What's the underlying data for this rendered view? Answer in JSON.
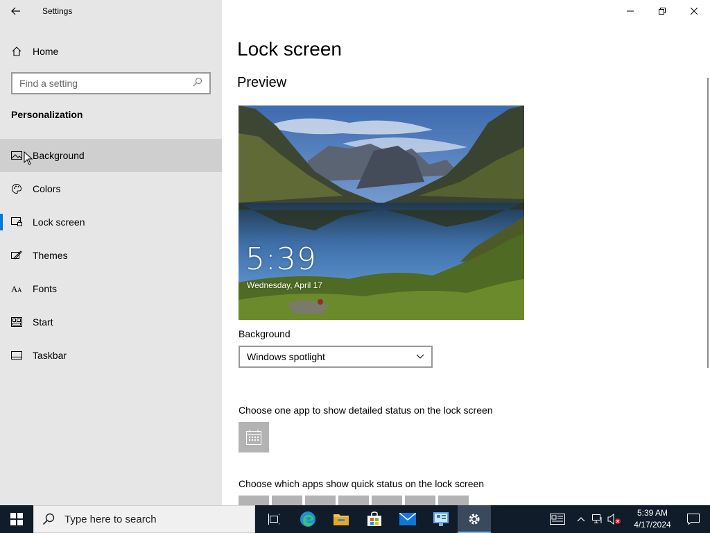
{
  "window": {
    "title": "Settings"
  },
  "sidebar": {
    "home_label": "Home",
    "search_placeholder": "Find a setting",
    "section_title": "Personalization",
    "items": [
      {
        "label": "Background",
        "icon": "picture-icon"
      },
      {
        "label": "Colors",
        "icon": "palette-icon"
      },
      {
        "label": "Lock screen",
        "icon": "lock-screen-icon"
      },
      {
        "label": "Themes",
        "icon": "themes-icon"
      },
      {
        "label": "Fonts",
        "icon": "fonts-icon"
      },
      {
        "label": "Start",
        "icon": "start-icon"
      },
      {
        "label": "Taskbar",
        "icon": "taskbar-icon"
      }
    ],
    "selected": "Lock screen",
    "hovered": "Background"
  },
  "main": {
    "title": "Lock screen",
    "preview_heading": "Preview",
    "preview_time": "5:39",
    "preview_date": "Wednesday, April 17",
    "background_label": "Background",
    "background_value": "Windows spotlight",
    "detailed_status_label": "Choose one app to show detailed status on the lock screen",
    "quick_status_label": "Choose which apps show quick status on the lock screen"
  },
  "taskbar": {
    "search_placeholder": "Type here to search",
    "time": "5:39 AM",
    "date": "4/17/2024",
    "apps": [
      "task-view-icon",
      "edge-icon",
      "file-explorer-icon",
      "store-icon",
      "mail-icon",
      "control-panel-icon",
      "settings-icon"
    ]
  },
  "colors": {
    "accent": "#0078d7",
    "sidebar_bg": "#e6e6e6",
    "taskbar_bg": "#101c2a"
  }
}
